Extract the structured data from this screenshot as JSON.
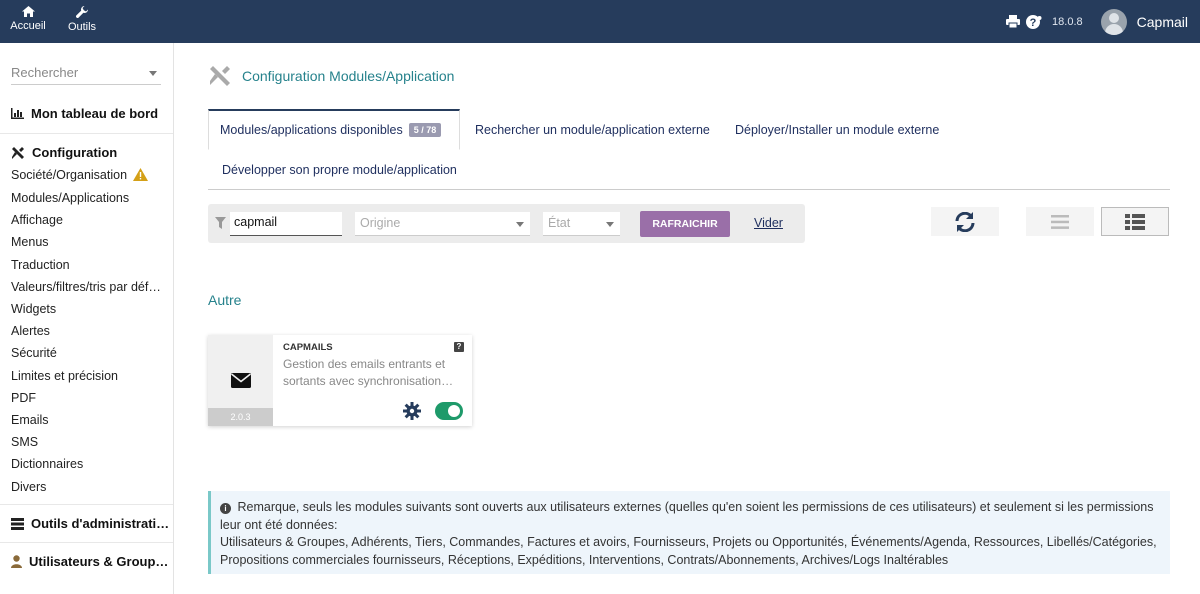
{
  "topbar": {
    "nav": [
      {
        "label": "Accueil",
        "icon": "home-icon"
      },
      {
        "label": "Outils",
        "icon": "wrench-icon"
      }
    ],
    "version": "18.0.8",
    "user": "Capmail"
  },
  "sidebar": {
    "search_placeholder": "Rechercher",
    "dashboard": "Mon tableau de bord",
    "config_title": "Configuration",
    "config_items": [
      "Société/Organisation",
      "Modules/Applications",
      "Affichage",
      "Menus",
      "Traduction",
      "Valeurs/filtres/tris par déf…",
      "Widgets",
      "Alertes",
      "Sécurité",
      "Limites et précision",
      "PDF",
      "Emails",
      "SMS",
      "Dictionnaires",
      "Divers"
    ],
    "admin_tools": "Outils d'administrati…",
    "users_groups": "Utilisateurs & Group…"
  },
  "main": {
    "title": "Configuration Modules/Application",
    "tabs": [
      {
        "label": "Modules/applications disponibles",
        "badge": "5 / 78"
      },
      {
        "label": "Rechercher un module/application externe"
      },
      {
        "label": "Déployer/Installer un module externe"
      },
      {
        "label": "Développer son propre module/application"
      }
    ],
    "filter": {
      "search_value": "capmail",
      "origin_placeholder": "Origine",
      "state_placeholder": "État",
      "refresh_label": "RAFRAICHIR",
      "clear_label": "Vider"
    },
    "section_title": "Autre",
    "modules": [
      {
        "name": "CAPMAILS",
        "description": "Gestion des emails entrants et sortants avec synchronisation…",
        "version": "2.0.3",
        "help": "?",
        "enabled": true
      }
    ],
    "note": {
      "intro": "Remarque, seuls les modules suivants sont ouverts aux utilisateurs externes (quelles qu'en soient les permissions de ces utilisateurs) et seulement si les permissions leur ont été données:",
      "list": "Utilisateurs & Groupes, Adhérents, Tiers, Commandes, Factures et avoirs, Fournisseurs, Projets ou Opportunités, Événements/Agenda, Ressources, Libellés/Catégories, Propositions commerciales fournisseurs, Réceptions, Expéditions, Interventions, Contrats/Abonnements, Archives/Logs Inaltérables"
    }
  },
  "colors": {
    "topbar": "#263c5c",
    "accent_teal": "#26828c",
    "refresh_button": "#9a6fa8",
    "toggle_on": "#1e9a6a"
  }
}
